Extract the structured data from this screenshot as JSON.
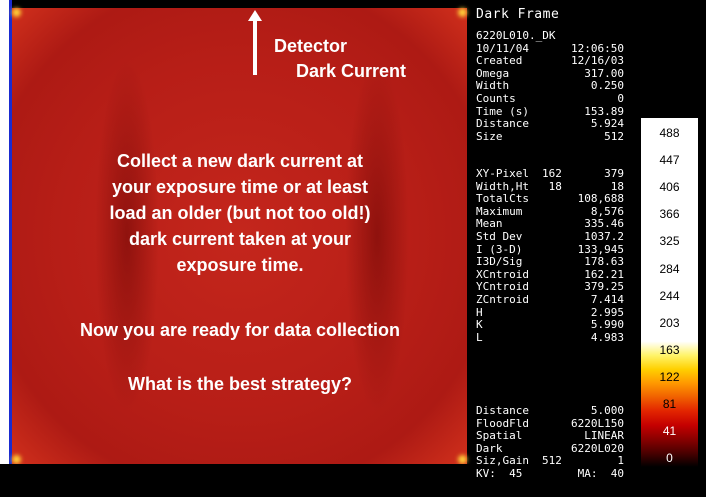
{
  "slide": {
    "detector_label": "Detector",
    "dark_current_label": "Dark Current",
    "paragraph_lines": [
      "Collect a new dark current at",
      "your exposure time or at least",
      "load an older (but not too old!)",
      "dark current taken at your",
      "exposure time."
    ],
    "ready_text": "Now you are ready for data collection",
    "question_text": "What is the best strategy?"
  },
  "panel": {
    "title": "Dark Frame",
    "header_rows": [
      {
        "k": "6220L010._DK",
        "v": ""
      },
      {
        "k": "10/11/04",
        "v": "12:06:50"
      },
      {
        "k": "Created",
        "v": "12/16/03"
      },
      {
        "k": "Omega",
        "v": "317.00"
      },
      {
        "k": "Width",
        "v": "0.250"
      },
      {
        "k": "Counts",
        "v": "0"
      },
      {
        "k": "Time (s)",
        "v": "153.89"
      },
      {
        "k": "Distance",
        "v": "5.924"
      },
      {
        "k": "Size",
        "v": "512"
      }
    ],
    "stats_rows": [
      {
        "k": "XY-Pixel",
        "m": "162",
        "v": "379"
      },
      {
        "k": "Width,Ht",
        "m": " 18",
        "v": "18"
      },
      {
        "k": "TotalCts",
        "m": "",
        "v": "108,688"
      },
      {
        "k": "Maximum",
        "m": "",
        "v": "8,576"
      },
      {
        "k": "Mean",
        "m": "",
        "v": "335.46"
      },
      {
        "k": "Std Dev",
        "m": "",
        "v": "1037.2"
      },
      {
        "k": "I (3-D)",
        "m": "",
        "v": "133,945"
      },
      {
        "k": "I3D/Sig",
        "m": "",
        "v": "178.63"
      },
      {
        "k": "XCntroid",
        "m": "",
        "v": "162.21"
      },
      {
        "k": "YCntroid",
        "m": "",
        "v": "379.25"
      },
      {
        "k": "ZCntroid",
        "m": "",
        "v": "7.414"
      },
      {
        "k": "H",
        "m": "",
        "v": "2.995"
      },
      {
        "k": "K",
        "m": "",
        "v": "5.990"
      },
      {
        "k": "L",
        "m": "",
        "v": "4.983"
      }
    ],
    "footer_rows": [
      {
        "k": "Distance",
        "m": "",
        "v": "5.000"
      },
      {
        "k": "FloodFld",
        "m": "",
        "v": "6220L150"
      },
      {
        "k": "Spatial",
        "m": "",
        "v": "LINEAR"
      },
      {
        "k": "Dark",
        "m": "",
        "v": "6220L020"
      },
      {
        "k": "Siz,Gain",
        "m": "512",
        "v": "1"
      },
      {
        "k": "KV:  45",
        "m": "",
        "v": "MA:  40"
      }
    ]
  },
  "colorbar": {
    "labels": [
      "488",
      "447",
      "406",
      "366",
      "325",
      "284",
      "244",
      "203",
      "163",
      "122",
      "81",
      "41",
      "0"
    ],
    "label_colors": [
      "#000000",
      "#000000",
      "#000000",
      "#000000",
      "#000000",
      "#000000",
      "#000000",
      "#000000",
      "#000000",
      "#000000",
      "#000000",
      "#ffffff",
      "#ffffff"
    ]
  }
}
